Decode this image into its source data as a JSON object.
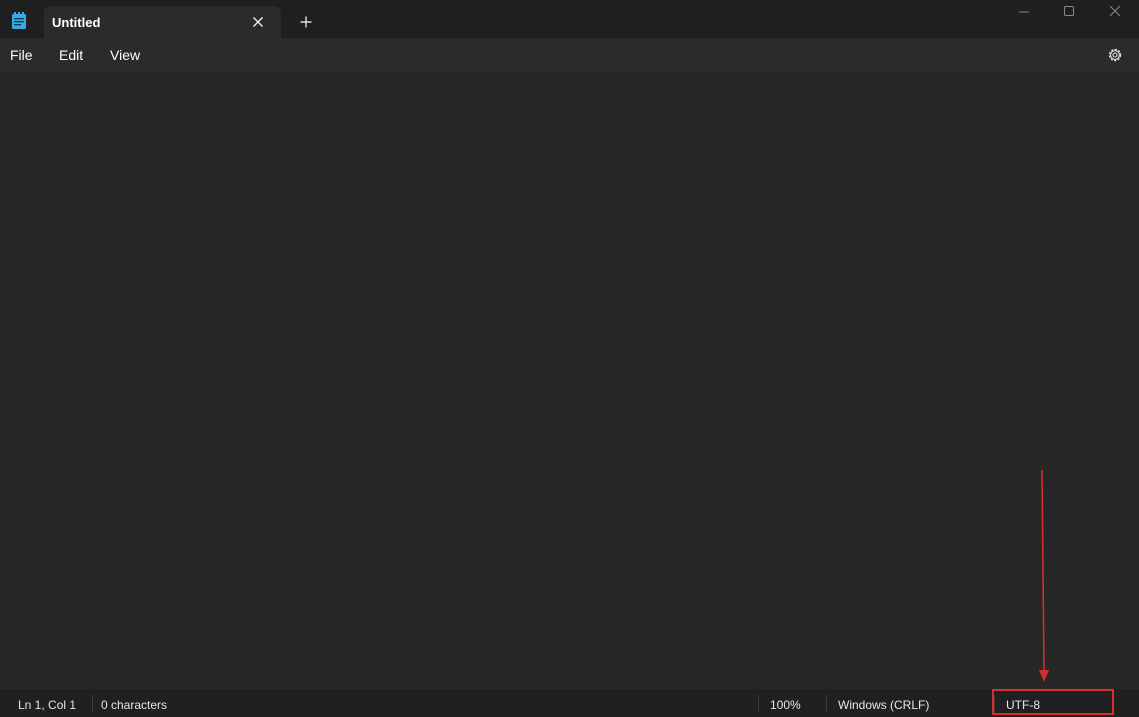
{
  "titlebar": {
    "tab_title": "Untitled",
    "icons": {
      "app": "notepad-icon",
      "tab_close": "close-icon",
      "new_tab": "plus-icon",
      "minimize": "minimize-icon",
      "maximize": "maximize-icon",
      "close": "close-window-icon"
    }
  },
  "menubar": {
    "items": [
      "File",
      "Edit",
      "View"
    ],
    "settings_icon": "gear-icon"
  },
  "editor": {
    "content": ""
  },
  "statusbar": {
    "position": "Ln 1, Col 1",
    "characters": "0 characters",
    "zoom": "100%",
    "line_ending": "Windows (CRLF)",
    "encoding": "UTF-8"
  },
  "colors": {
    "background": "#272727",
    "titlebar": "#1f1f1f",
    "tab": "#2b2b2b",
    "statusbar": "#202020",
    "annotation": "#d32f2f"
  }
}
